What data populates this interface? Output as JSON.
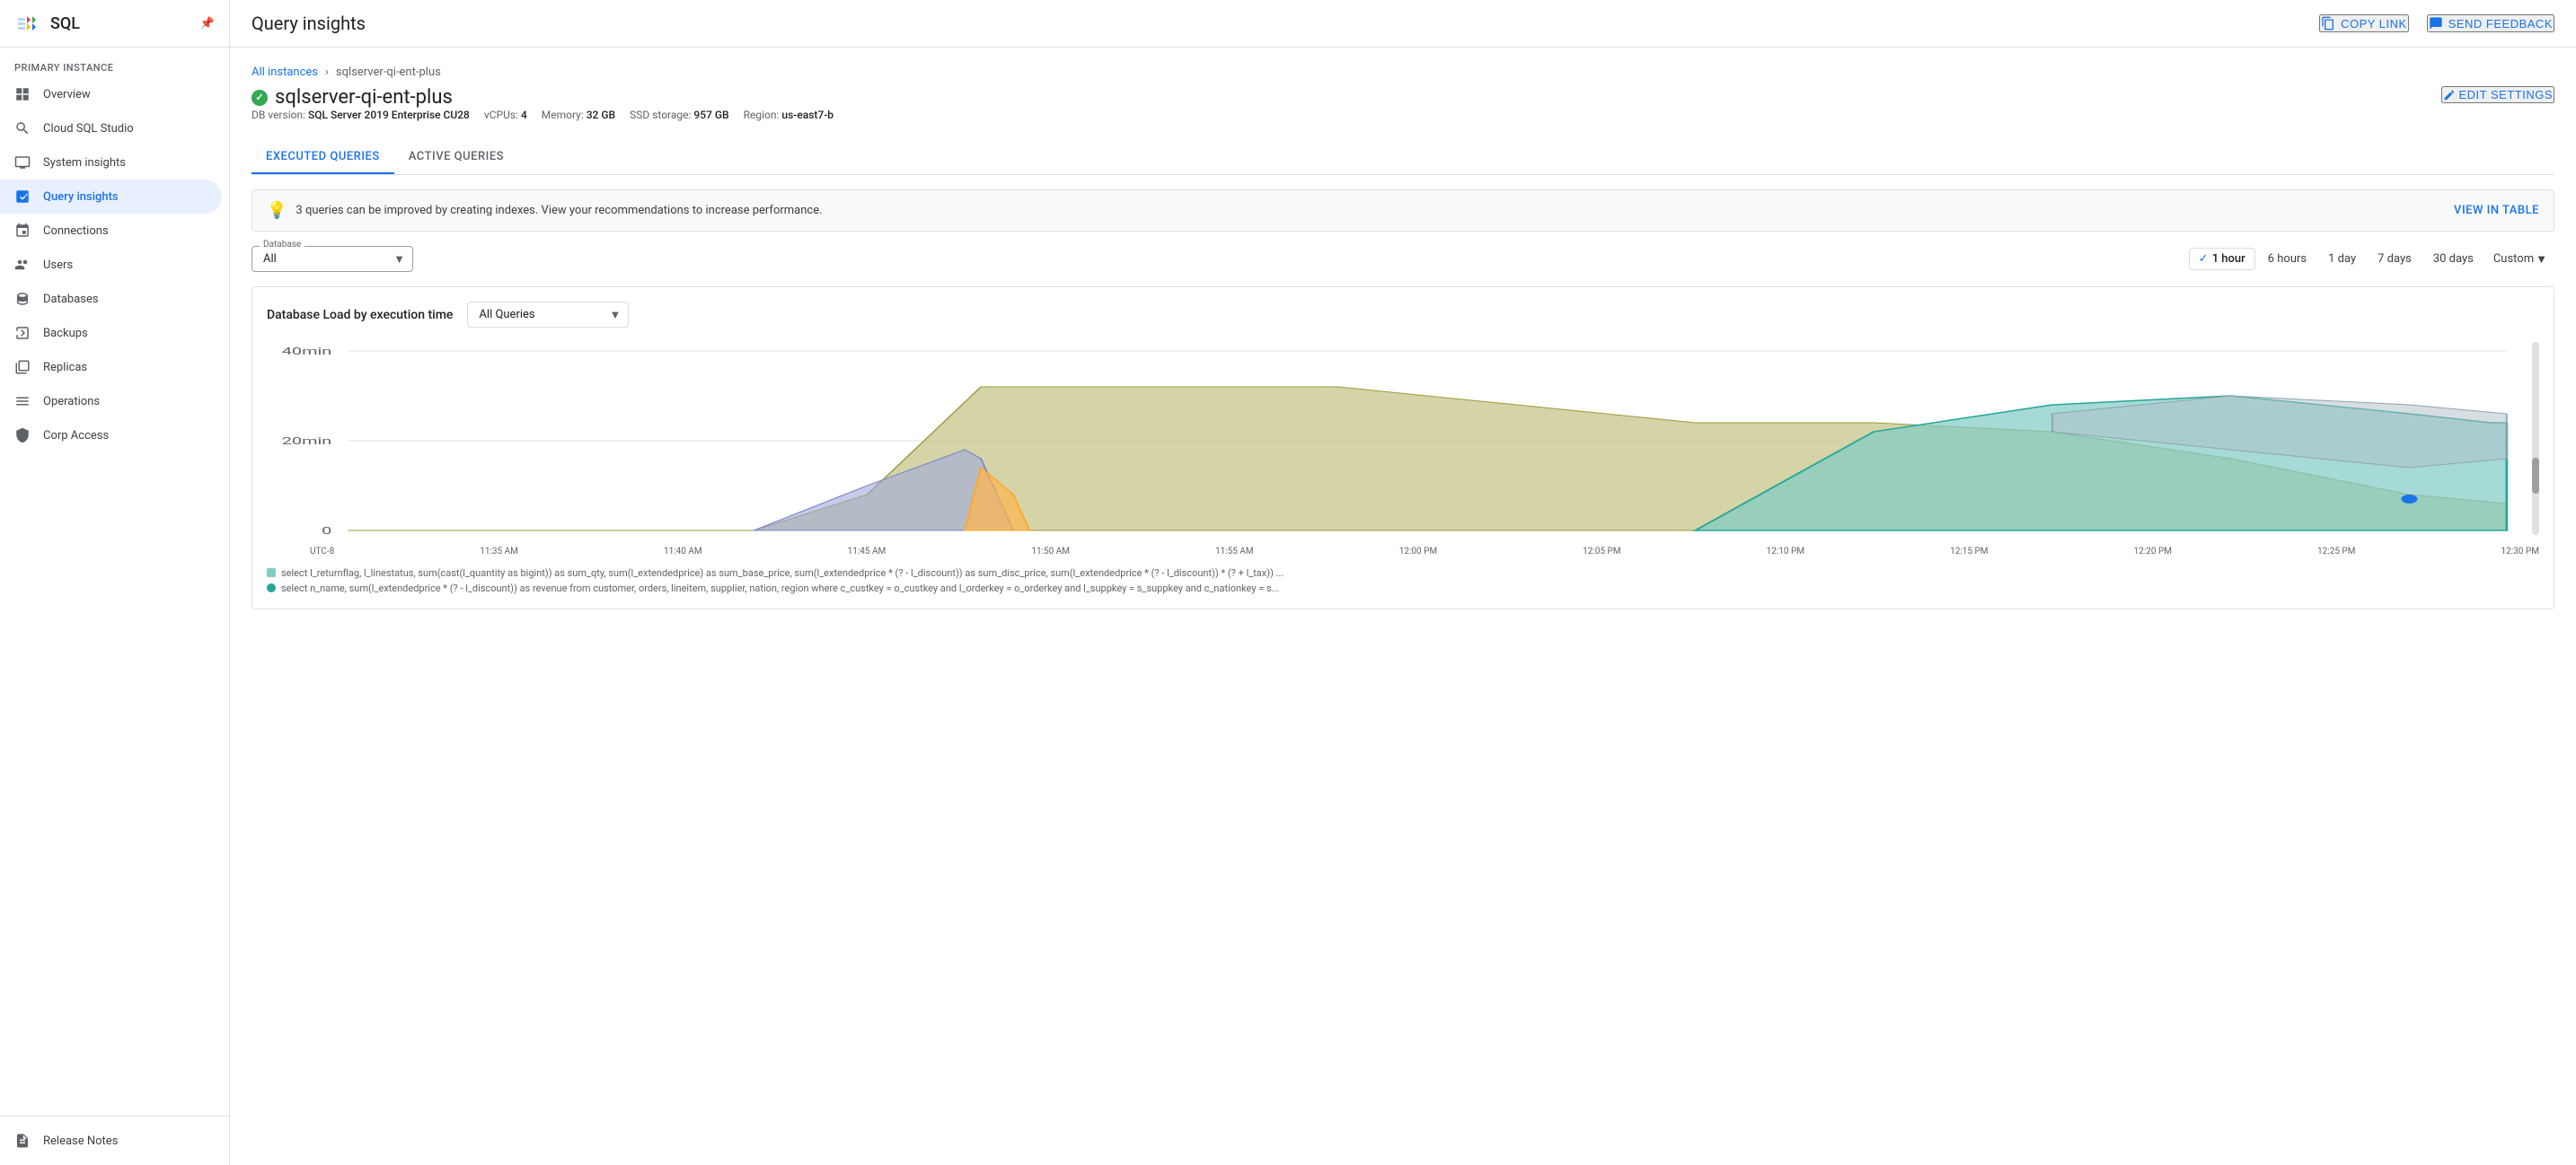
{
  "sidebar": {
    "logo_text": "SQL",
    "section_label": "Primary instance",
    "items": [
      {
        "id": "overview",
        "label": "Overview",
        "icon": "grid"
      },
      {
        "id": "cloud-sql-studio",
        "label": "Cloud SQL Studio",
        "icon": "search"
      },
      {
        "id": "system-insights",
        "label": "System insights",
        "icon": "monitor"
      },
      {
        "id": "query-insights",
        "label": "Query insights",
        "icon": "chart",
        "active": true
      },
      {
        "id": "connections",
        "label": "Connections",
        "icon": "connections"
      },
      {
        "id": "users",
        "label": "Users",
        "icon": "users"
      },
      {
        "id": "databases",
        "label": "Databases",
        "icon": "databases"
      },
      {
        "id": "backups",
        "label": "Backups",
        "icon": "backups"
      },
      {
        "id": "replicas",
        "label": "Replicas",
        "icon": "replicas"
      },
      {
        "id": "operations",
        "label": "Operations",
        "icon": "operations"
      },
      {
        "id": "corp-access",
        "label": "Corp Access",
        "icon": "corp"
      }
    ],
    "bottom_items": [
      {
        "id": "release-notes",
        "label": "Release Notes",
        "icon": "notes"
      }
    ]
  },
  "topbar": {
    "title": "Query insights",
    "copy_link_label": "COPY LINK",
    "send_feedback_label": "SEND FEEDBACK"
  },
  "breadcrumb": {
    "parent": "All instances",
    "current": "sqlserver-qi-ent-plus"
  },
  "instance": {
    "name": "sqlserver-qi-ent-plus",
    "db_version_label": "DB version:",
    "db_version": "SQL Server 2019 Enterprise CU28",
    "vcpus_label": "vCPUs:",
    "vcpus": "4",
    "memory_label": "Memory:",
    "memory": "32 GB",
    "ssd_label": "SSD storage:",
    "ssd": "957 GB",
    "region_label": "Region:",
    "region": "us-east7-b",
    "edit_settings_label": "EDIT SETTINGS"
  },
  "tabs": [
    {
      "id": "executed",
      "label": "EXECUTED QUERIES",
      "active": true
    },
    {
      "id": "active",
      "label": "ACTIVE QUERIES",
      "active": false
    }
  ],
  "info_banner": {
    "text": "3 queries can be improved by creating indexes. View your recommendations to increase performance.",
    "link_label": "VIEW IN TABLE"
  },
  "controls": {
    "database_label": "Database",
    "database_value": "All",
    "time_filters": [
      {
        "label": "1 hour",
        "active": true
      },
      {
        "label": "6 hours",
        "active": false
      },
      {
        "label": "1 day",
        "active": false
      },
      {
        "label": "7 days",
        "active": false
      },
      {
        "label": "30 days",
        "active": false
      },
      {
        "label": "Custom",
        "active": false,
        "has_arrow": true
      }
    ]
  },
  "chart": {
    "title": "Database Load by execution time",
    "query_filter_value": "All Queries",
    "y_labels": [
      "40min",
      "20min",
      "0"
    ],
    "x_labels": [
      "UTC-8",
      "11:35 AM",
      "11:40 AM",
      "11:45 AM",
      "11:50 AM",
      "11:55 AM",
      "12:00 PM",
      "12:05 PM",
      "12:10 PM",
      "12:15 PM",
      "12:20 PM",
      "12:25 PM",
      "12:30 PM"
    ],
    "legend": [
      {
        "color": "#80cbc4",
        "text": "select l_returnflag, l_linestatus, sum(cast(l_quantity as bigint)) as sum_qty, sum(l_extendedprice) as sum_base_price, sum(l_extendedprice * (? - l_discount)) as sum_disc_price, sum(l_extendedprice * (? - l_discount)) * (? + l_tax)) ..."
      },
      {
        "color": "#4db6ac",
        "text": "select n_name, sum(l_extendedprice * (? - l_discount)) as revenue from customer, orders, lineitem, supplier, nation, region where c_custkey = o_custkey and l_orderkey = o_orderkey and l_suppkey = s_suppkey and c_nationkey = s..."
      }
    ]
  }
}
